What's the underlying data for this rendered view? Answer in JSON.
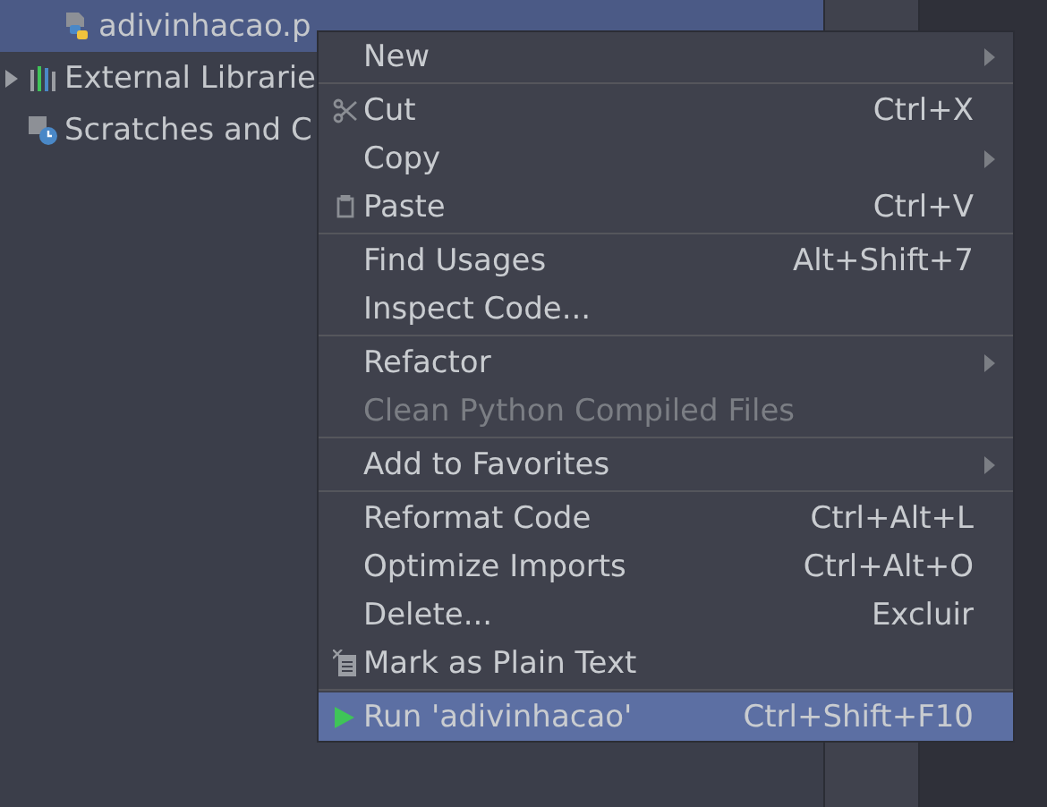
{
  "tree": {
    "items": [
      {
        "label": "adivinhacao.p",
        "selected": true
      },
      {
        "label": "External Librarie",
        "expanded": false,
        "selected": false
      },
      {
        "label": "Scratches and C",
        "selected": false
      }
    ]
  },
  "context_menu": {
    "items": [
      {
        "kind": "item",
        "label": "New",
        "submenu": true,
        "disabled": false,
        "selected": false
      },
      {
        "kind": "separator"
      },
      {
        "kind": "item",
        "label": "Cut",
        "shortcut": "Ctrl+X",
        "disabled": false,
        "selected": false
      },
      {
        "kind": "item",
        "label": "Copy",
        "submenu": true,
        "disabled": false,
        "selected": false
      },
      {
        "kind": "item",
        "label": "Paste",
        "shortcut": "Ctrl+V",
        "disabled": false,
        "selected": false
      },
      {
        "kind": "separator"
      },
      {
        "kind": "item",
        "label": "Find Usages",
        "shortcut": "Alt+Shift+7",
        "disabled": false,
        "selected": false
      },
      {
        "kind": "item",
        "label": "Inspect Code...",
        "disabled": false,
        "selected": false
      },
      {
        "kind": "separator"
      },
      {
        "kind": "item",
        "label": "Refactor",
        "submenu": true,
        "disabled": false,
        "selected": false
      },
      {
        "kind": "item",
        "label": "Clean Python Compiled Files",
        "disabled": true,
        "selected": false
      },
      {
        "kind": "separator"
      },
      {
        "kind": "item",
        "label": "Add to Favorites",
        "submenu": true,
        "disabled": false,
        "selected": false
      },
      {
        "kind": "separator"
      },
      {
        "kind": "item",
        "label": "Reformat Code",
        "shortcut": "Ctrl+Alt+L",
        "disabled": false,
        "selected": false
      },
      {
        "kind": "item",
        "label": "Optimize Imports",
        "shortcut": "Ctrl+Alt+O",
        "disabled": false,
        "selected": false
      },
      {
        "kind": "item",
        "label": "Delete...",
        "shortcut": "Excluir",
        "disabled": false,
        "selected": false
      },
      {
        "kind": "item",
        "label": "Mark as Plain Text",
        "disabled": false,
        "selected": false
      },
      {
        "kind": "separator"
      },
      {
        "kind": "item",
        "label": "Run 'adivinhacao'",
        "shortcut": "Ctrl+Shift+F10",
        "disabled": false,
        "selected": true
      }
    ]
  }
}
